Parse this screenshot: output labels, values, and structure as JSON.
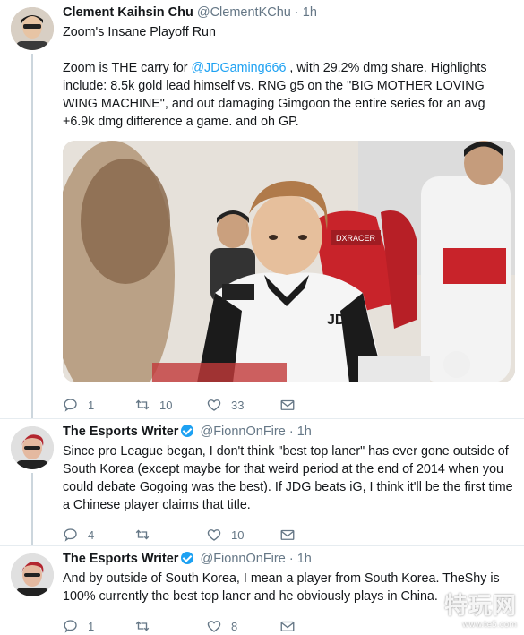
{
  "tweets": [
    {
      "name": "Clement Kaihsin Chu",
      "handle": "@ClementKChu",
      "time": "1h",
      "title": "Zoom's Insane Playoff Run",
      "text_pre": "Zoom is THE carry for ",
      "mention": "@JDGaming666",
      "text_post": " , with 29.2% dmg share. Highlights include: 8.5k gold lead himself vs. RNG g5 on the \"BIG MOTHER LOVING WING MACHINE\", and out damaging Gimgoon the entire series for an avg +6.9k dmg difference a game. and oh GP.",
      "photo_logo": "JD",
      "photo_chair": "DXRACER",
      "replies": "1",
      "retweets": "10",
      "likes": "33"
    },
    {
      "name": "The Esports Writer",
      "handle": "@FionnOnFire",
      "time": "1h",
      "text": "Since pro League began, I don't think \"best top laner\" has ever gone outside of South Korea (except maybe for that weird period at the end of 2014 when you could debate Gogoing was the best). If JDG beats iG, I think it'll be the first time a Chinese player claims that title.",
      "replies": "4",
      "retweets": "",
      "likes": "10"
    },
    {
      "name": "The Esports Writer",
      "handle": "@FionnOnFire",
      "time": "1h",
      "text": "And by outside of South Korea, I mean a player from South Korea. TheShy is 100% currently the best top laner and he obviously plays in China.",
      "replies": "1",
      "retweets": "",
      "likes": "8"
    }
  ],
  "separator": "·",
  "watermark": {
    "big": "特玩网",
    "small": "www.te5.com"
  },
  "colors": {
    "link": "#1da1f2",
    "muted": "#657786",
    "verified": "#1da1f2"
  }
}
